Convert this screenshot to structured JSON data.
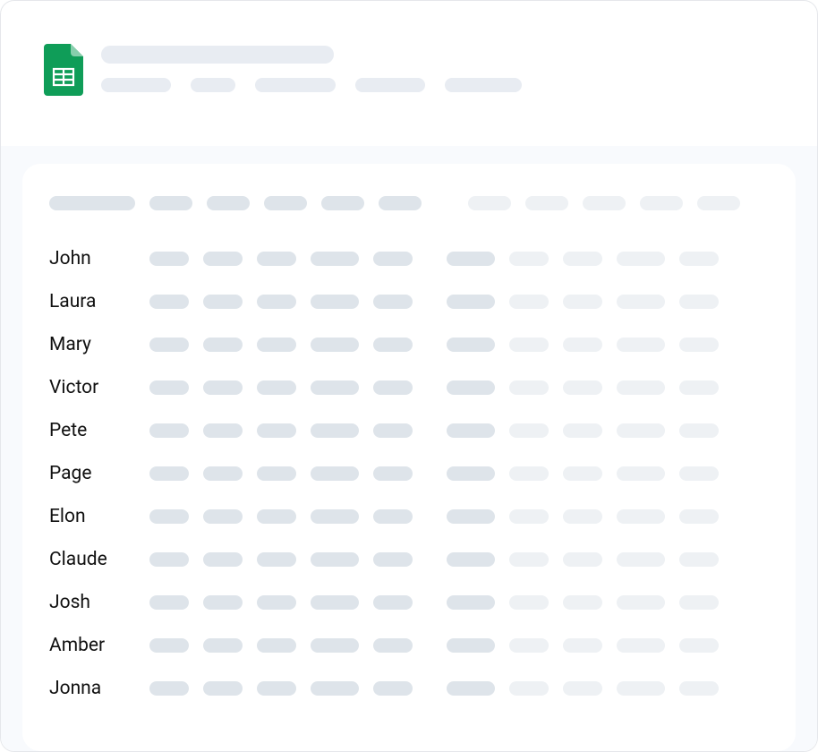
{
  "app": {
    "icon": "google-sheets"
  },
  "rows": [
    {
      "name": "John"
    },
    {
      "name": "Laura"
    },
    {
      "name": "Mary"
    },
    {
      "name": "Victor"
    },
    {
      "name": "Pete"
    },
    {
      "name": "Page"
    },
    {
      "name": "Elon"
    },
    {
      "name": "Claude"
    },
    {
      "name": "Josh"
    },
    {
      "name": "Amber"
    },
    {
      "name": "Jonna"
    }
  ]
}
